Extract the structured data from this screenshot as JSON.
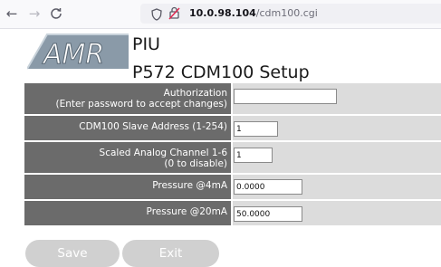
{
  "browser": {
    "url_host": "10.0.98.104",
    "url_path": "/cdm100.cgi"
  },
  "header": {
    "logo_text": "AMR",
    "title_line1": "PIU",
    "title_line2": "P572 CDM100 Setup"
  },
  "form": {
    "rows": [
      {
        "label_line1": "Authorization",
        "label_line2": "(Enter password to accept changes)",
        "value": ""
      },
      {
        "label_line1": "CDM100 Slave Address (1-254)",
        "label_line2": "",
        "value": "1"
      },
      {
        "label_line1": "Scaled Analog Channel 1-6",
        "label_line2": "(0 to disable)",
        "value": "1"
      },
      {
        "label_line1": "Pressure @4mA",
        "label_line2": "",
        "value": "0.0000"
      },
      {
        "label_line1": "Pressure @20mA",
        "label_line2": "",
        "value": "50.0000"
      }
    ]
  },
  "buttons": {
    "save_label": "Save",
    "exit_label": "Exit"
  },
  "colors": {
    "label_bg": "#6b6b6b",
    "value_bg": "#dcdcdc",
    "button_bg": "#d0d0d0",
    "logo_fill": "#8a9aa8"
  }
}
